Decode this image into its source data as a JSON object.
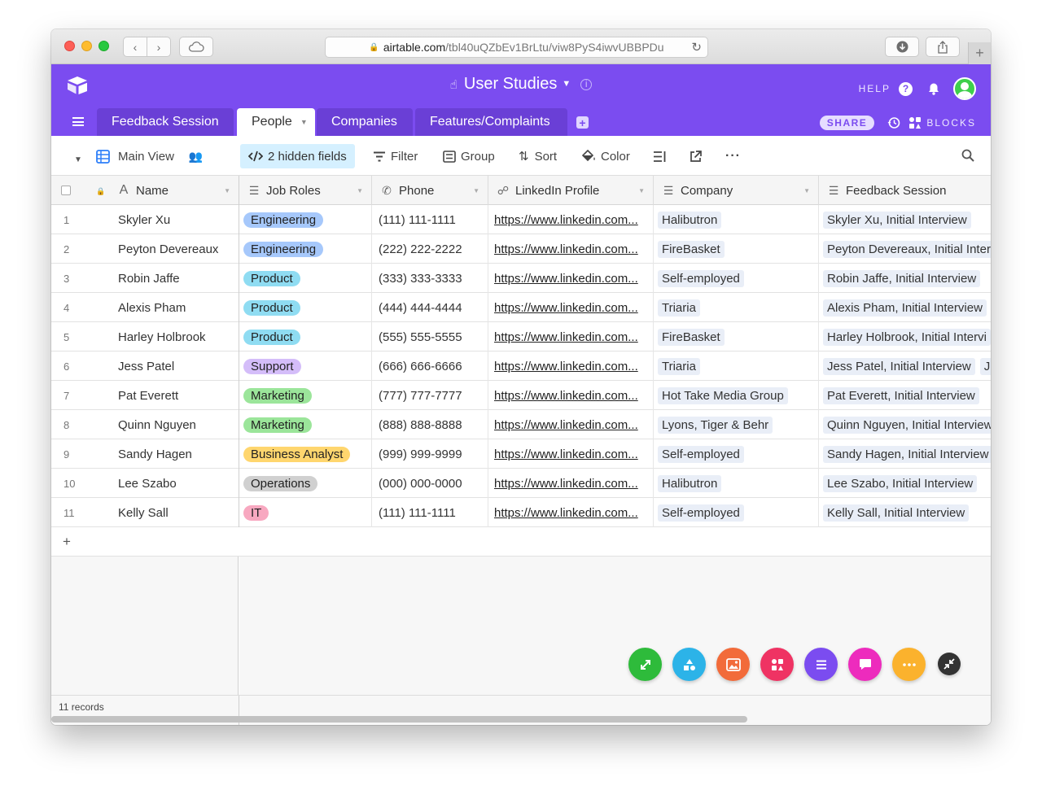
{
  "browser": {
    "url_domain": "airtable.com",
    "url_path": "/tbl40uQZbEv1BrLtu/viw8PyS4iwvUBBPDu"
  },
  "header": {
    "base_title": "User Studies",
    "help_label": "HELP",
    "share_label": "SHARE",
    "blocks_label": "BLOCKS",
    "accent_color": "#7b4cf0"
  },
  "tabs": [
    {
      "label": "Feedback Session"
    },
    {
      "label": "People"
    },
    {
      "label": "Companies"
    },
    {
      "label": "Features/Complaints"
    }
  ],
  "toolbar": {
    "view_name": "Main View",
    "hidden_fields": "2 hidden fields",
    "filter": "Filter",
    "group": "Group",
    "sort": "Sort",
    "color": "Color"
  },
  "columns": [
    {
      "label": "Name",
      "icon": "text-icon"
    },
    {
      "label": "Job Roles",
      "icon": "multi-select-icon"
    },
    {
      "label": "Phone",
      "icon": "phone-icon"
    },
    {
      "label": "LinkedIn Profile",
      "icon": "link-icon"
    },
    {
      "label": "Company",
      "icon": "linked-record-icon"
    },
    {
      "label": "Feedback Session",
      "icon": "linked-record-icon"
    }
  ],
  "rows": [
    {
      "num": "1",
      "name": "Skyler Xu",
      "role": "Engineering",
      "role_color": "#a6c8fb",
      "phone": "(111) 111-1111",
      "linkedin": "https://www.linkedin.com...",
      "company": "Halibutron",
      "session": "Skyler Xu, Initial Interview"
    },
    {
      "num": "2",
      "name": "Peyton Devereaux",
      "role": "Engineering",
      "role_color": "#a6c8fb",
      "phone": "(222) 222-2222",
      "linkedin": "https://www.linkedin.com...",
      "company": "FireBasket",
      "session": "Peyton Devereaux, Initial Inter"
    },
    {
      "num": "3",
      "name": "Robin Jaffe",
      "role": "Product",
      "role_color": "#8fdcf2",
      "phone": "(333) 333-3333",
      "linkedin": "https://www.linkedin.com...",
      "company": "Self-employed",
      "session": "Robin Jaffe, Initial Interview"
    },
    {
      "num": "4",
      "name": "Alexis Pham",
      "role": "Product",
      "role_color": "#8fdcf2",
      "phone": "(444) 444-4444",
      "linkedin": "https://www.linkedin.com...",
      "company": "Triaria",
      "session": "Alexis Pham, Initial Interview"
    },
    {
      "num": "5",
      "name": "Harley Holbrook",
      "role": "Product",
      "role_color": "#8fdcf2",
      "phone": "(555) 555-5555",
      "linkedin": "https://www.linkedin.com...",
      "company": "FireBasket",
      "session": "Harley Holbrook, Initial Intervi"
    },
    {
      "num": "6",
      "name": "Jess Patel",
      "role": "Support",
      "role_color": "#d4bdf9",
      "phone": "(666) 666-6666",
      "linkedin": "https://www.linkedin.com...",
      "company": "Triaria",
      "session": "Jess Patel, Initial Interview"
    },
    {
      "num": "7",
      "name": "Pat Everett",
      "role": "Marketing",
      "role_color": "#9be59a",
      "phone": "(777) 777-7777",
      "linkedin": "https://www.linkedin.com...",
      "company": "Hot Take Media Group",
      "session": "Pat Everett, Initial Interview"
    },
    {
      "num": "8",
      "name": "Quinn Nguyen",
      "role": "Marketing",
      "role_color": "#9be59a",
      "phone": "(888) 888-8888",
      "linkedin": "https://www.linkedin.com...",
      "company": "Lyons, Tiger & Behr",
      "session": "Quinn Nguyen, Initial Interview"
    },
    {
      "num": "9",
      "name": "Sandy Hagen",
      "role": "Business Analyst",
      "role_color": "#ffd66e",
      "phone": "(999) 999-9999",
      "linkedin": "https://www.linkedin.com...",
      "company": "Self-employed",
      "session": "Sandy Hagen, Initial Interview"
    },
    {
      "num": "10",
      "name": "Lee Szabo",
      "role": "Operations",
      "role_color": "#d0d0d0",
      "phone": "(000) 000-0000",
      "linkedin": "https://www.linkedin.com...",
      "company": "Halibutron",
      "session": "Lee Szabo, Initial Interview"
    },
    {
      "num": "11",
      "name": "Kelly Sall",
      "role": "IT",
      "role_color": "#f8a8c0",
      "phone": "(111) 111-1111",
      "linkedin": "https://www.linkedin.com...",
      "company": "Self-employed",
      "session": "Kelly Sall, Initial Interview"
    }
  ],
  "row6_overflow": "J",
  "footer": {
    "record_count": "11 records"
  },
  "fab_colors": [
    "#2ebb3b",
    "#2cb3e8",
    "#f26b3a",
    "#ef3363",
    "#7b4cf0",
    "#ed2bbd",
    "#fbb22d",
    "#333333"
  ]
}
